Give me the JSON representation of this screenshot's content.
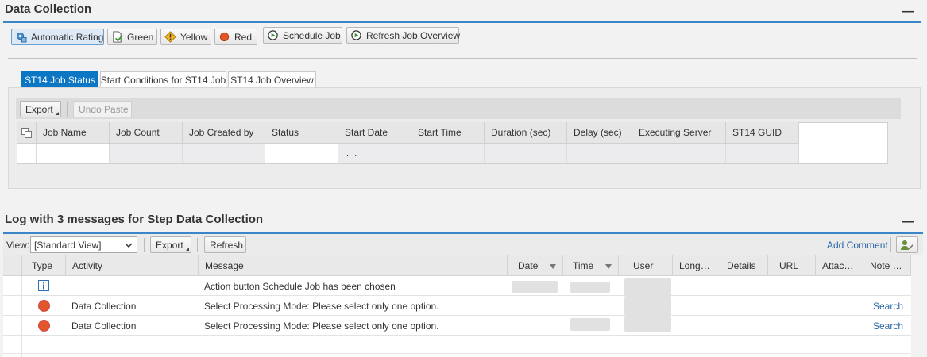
{
  "data_collection": {
    "title": "Data Collection",
    "minimize": "—",
    "toolbar": [
      {
        "label": "Automatic Rating",
        "icon": "gear-rating-icon"
      },
      {
        "label": "Green",
        "icon": "document-check-icon"
      },
      {
        "label": "Yellow",
        "icon": "warning-icon"
      },
      {
        "label": "Red",
        "icon": "red-light-icon"
      },
      {
        "label": "Schedule Job",
        "icon": "schedule-icon"
      },
      {
        "label": "Refresh Job Overview",
        "icon": "refresh-job-icon"
      }
    ],
    "tabs": [
      "ST14 Job Status",
      "Start Conditions for ST14 Job",
      "ST14 Job Overview"
    ],
    "grid_toolbar": {
      "export_label": "Export",
      "undo_paste_label": "Undo Paste"
    },
    "columns": [
      "Job Name",
      "Job Count",
      "Job Created by",
      "Status",
      "Start Date",
      "Start Time",
      "Duration (sec)",
      "Delay (sec)",
      "Executing Server",
      "ST14 GUID"
    ],
    "row_start_date": ". ."
  },
  "log": {
    "title": "Log with 3 messages for Step Data Collection",
    "minimize": "—",
    "view_label": "View:",
    "view_value": "[Standard View]",
    "export_label": "Export",
    "refresh_label": "Refresh",
    "add_comment_label": "Add Comment",
    "columns": [
      "Type",
      "Activity",
      "Message",
      "Date",
      "Time",
      "User",
      "Long…",
      "Details",
      "URL",
      "Attac…",
      "Note …"
    ],
    "rows": [
      {
        "type": "info",
        "activity": "",
        "message": "Action button Schedule Job has been chosen",
        "note": ""
      },
      {
        "type": "error",
        "activity": "Data Collection",
        "message": "Select Processing Mode: Please select only one option.",
        "note": "Search"
      },
      {
        "type": "error",
        "activity": "Data Collection",
        "message": "Select Processing Mode: Please select only one option.",
        "note": "Search"
      }
    ]
  },
  "colors": {
    "accent": "#0b76c4",
    "error": "#e2562b",
    "link": "#2866a6"
  }
}
